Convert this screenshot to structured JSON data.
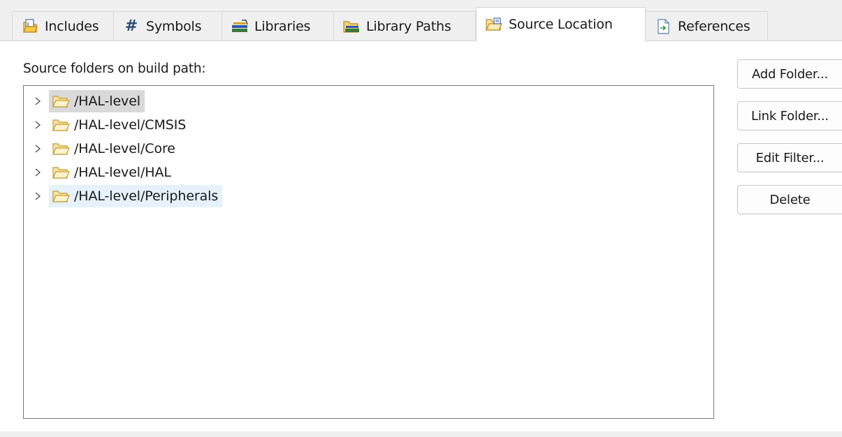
{
  "tabs": [
    {
      "label": "Includes",
      "icon": "includes-icon",
      "selected": false
    },
    {
      "label": "Symbols",
      "icon": "hash-icon",
      "selected": false
    },
    {
      "label": "Libraries",
      "icon": "libraries-icon",
      "selected": false
    },
    {
      "label": "Library Paths",
      "icon": "library-paths-icon",
      "selected": false
    },
    {
      "label": "Source Location",
      "icon": "source-location-icon",
      "selected": true
    },
    {
      "label": "References",
      "icon": "references-icon",
      "selected": false
    }
  ],
  "tree": {
    "heading": "Source folders on build path:",
    "items": [
      {
        "label": "/HAL-level",
        "icon": "folder-icon",
        "expandable": true,
        "state": "selected-inactive"
      },
      {
        "label": "/HAL-level/CMSIS",
        "icon": "folder-icon",
        "expandable": true,
        "state": "normal"
      },
      {
        "label": "/HAL-level/Core",
        "icon": "folder-icon",
        "expandable": true,
        "state": "normal"
      },
      {
        "label": "/HAL-level/HAL",
        "icon": "folder-icon",
        "expandable": true,
        "state": "normal"
      },
      {
        "label": "/HAL-level/Peripherals",
        "icon": "folder-icon",
        "expandable": true,
        "state": "hover"
      }
    ]
  },
  "buttons": {
    "add_folder": "Add Folder...",
    "link_folder": "Link Folder...",
    "edit_filter": "Edit Filter...",
    "delete": "Delete"
  },
  "colors": {
    "selection_inactive": "#d9d9d9",
    "hover": "#e5f1fb",
    "folder": "#f3c14b"
  }
}
